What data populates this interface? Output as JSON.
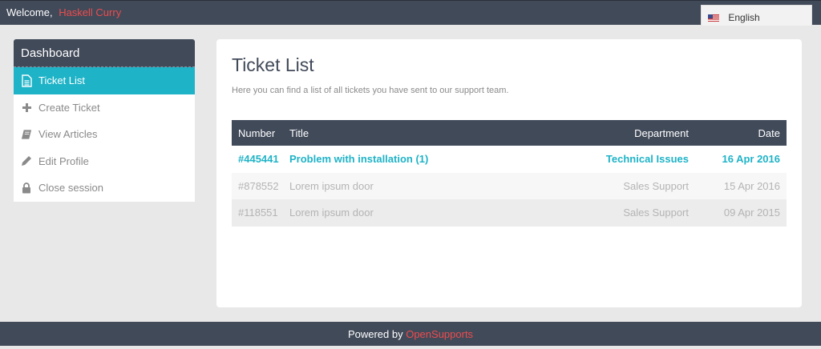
{
  "topbar": {
    "welcome_label": "Welcome,",
    "user_name": "Haskell Curry",
    "language": "English"
  },
  "sidebar": {
    "header": "Dashboard",
    "items": [
      {
        "label": "Ticket List",
        "icon": "file-icon"
      },
      {
        "label": "Create Ticket",
        "icon": "plus-icon"
      },
      {
        "label": "View Articles",
        "icon": "book-icon"
      },
      {
        "label": "Edit Profile",
        "icon": "pencil-icon"
      },
      {
        "label": "Close session",
        "icon": "lock-icon"
      }
    ]
  },
  "main": {
    "title": "Ticket List",
    "description": "Here you can find a list of all tickets you have sent to our support team.",
    "table": {
      "columns": [
        "Number",
        "Title",
        "Department",
        "Date"
      ],
      "rows": [
        {
          "number": "#445441",
          "title": "Problem with installation (1)",
          "department": "Technical Issues",
          "date": "16 Apr 2016",
          "unread": true
        },
        {
          "number": "#878552",
          "title": "Lorem ipsum door",
          "department": "Sales Support",
          "date": "15 Apr 2016",
          "unread": false
        },
        {
          "number": "#118551",
          "title": "Lorem ipsum door",
          "department": "Sales Support",
          "date": "09 Apr 2015",
          "unread": false
        }
      ]
    }
  },
  "footer": {
    "powered_by": "Powered by",
    "brand": "OpenSupports"
  },
  "colors": {
    "dark": "#414a59",
    "accent": "#1fb3c7",
    "brand_red": "#ec4c4e"
  }
}
